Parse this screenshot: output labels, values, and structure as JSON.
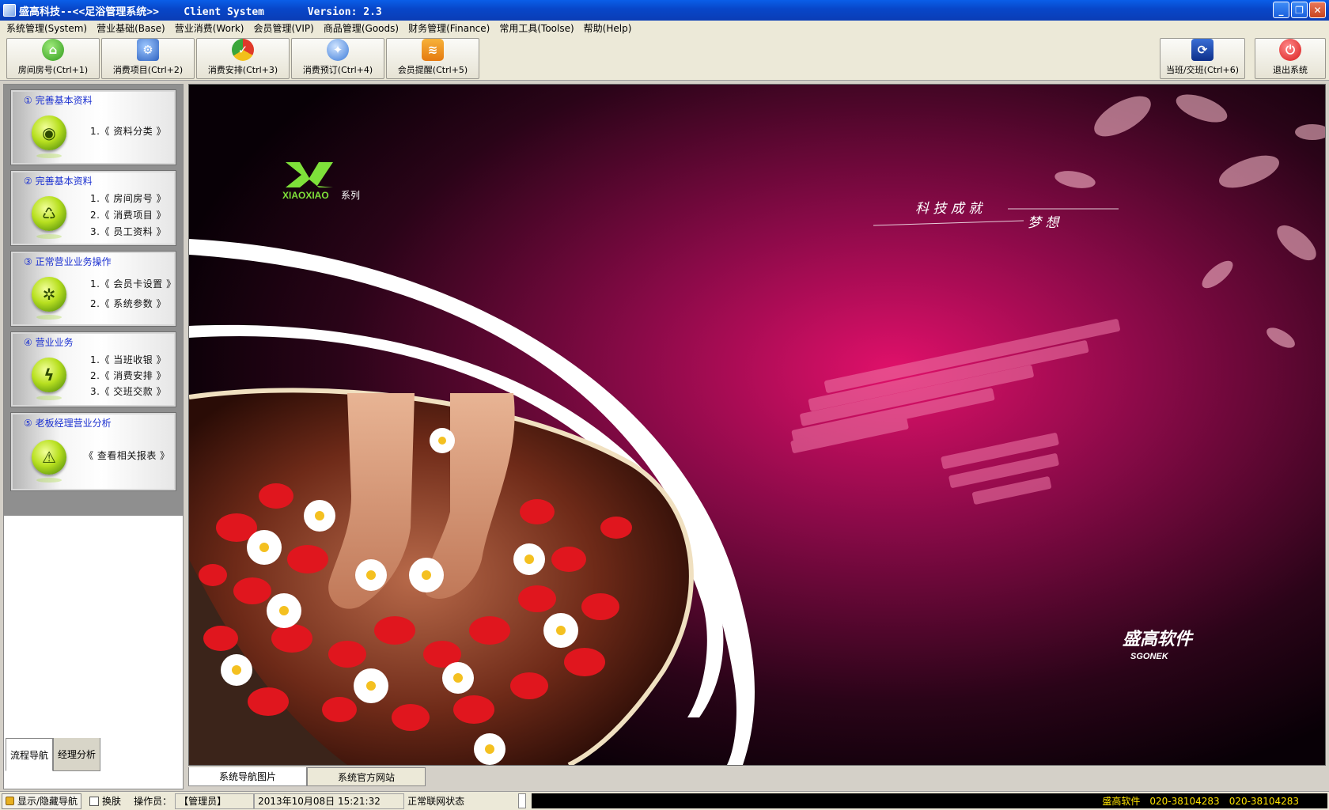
{
  "window": {
    "title": "盛高科技--<<足浴管理系统>>    Client System       Version: 2.3",
    "buttons": {
      "minimize": "_",
      "restore": "❐",
      "close": "✕"
    }
  },
  "menu": [
    "系统管理(System)",
    "营业基础(Base)",
    "营业消费(Work)",
    "会员管理(VIP)",
    "商品管理(Goods)",
    "财务管理(Finance)",
    "常用工具(Toolse)",
    "帮助(Help)"
  ],
  "toolbar": {
    "room": "房间房号(Ctrl+1)",
    "items": "消费项目(Ctrl+2)",
    "arrange": "消费安排(Ctrl+3)",
    "reserve": "消费预订(Ctrl+4)",
    "remind": "会员提醒(Ctrl+5)",
    "shift": "当班/交班(Ctrl+6)",
    "exit": "退出系统"
  },
  "nav": {
    "card1": {
      "title": "① 完善基本资料",
      "link1": "1.《 资料分类 》"
    },
    "card2": {
      "title": "② 完善基本资料",
      "link1": "1.《 房间房号 》",
      "link2": "2.《 消费项目 》",
      "link3": "3.《 员工资料 》"
    },
    "card3": {
      "title": "③ 正常营业业务操作",
      "link1": "1.《 会员卡设置 》",
      "link2": "2.《 系统参数 》"
    },
    "card4": {
      "title": "④ 营业业务",
      "link1": "1.《 当班收银 》",
      "link2": "2.《 消费安排 》",
      "link3": "3.《 交班交款 》"
    },
    "card5": {
      "title": "⑤ 老板经理营业分析",
      "link1": "《 查看相关报表 》"
    },
    "tabs": {
      "flow": "流程导航",
      "manager": "经理分析"
    }
  },
  "banner": {
    "series_logo": "XIAOXIAO",
    "series_suffix": "系列",
    "slogan1": "科  技  成  就",
    "slogan2": "梦  想",
    "brand_cn": "盛高软件",
    "brand_en": "SGONEK"
  },
  "main_tabs": {
    "nav_image": "系统导航图片",
    "website": "系统官方网站"
  },
  "status": {
    "toggle_nav": "显示/隐藏导航",
    "skin": "换肤",
    "operator_label": "操作员：",
    "operator": "【管理员】",
    "datetime": "2013年10月08日 15:21:32",
    "network": "正常联网状态",
    "company": "盛高软件",
    "phone1": "020-38104283",
    "phone2": "020-38104283"
  }
}
